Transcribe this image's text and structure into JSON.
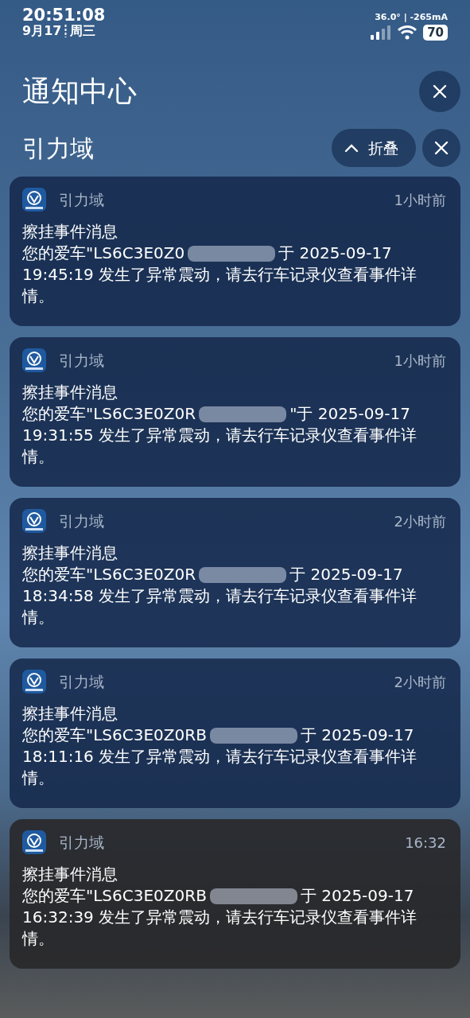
{
  "status_bar": {
    "time": "20:51:08",
    "date": "9月17",
    "weekday": "周三",
    "device_info": "36.0° | -265mA",
    "battery": "70"
  },
  "header": {
    "title": "通知中心"
  },
  "group": {
    "name": "引力域",
    "collapse_label": "折叠"
  },
  "notifications": [
    {
      "app": "引力域",
      "time": "1小时前",
      "title": "擦挂事件消息",
      "body_start": "您的爱车\"LS6C3E0Z0",
      "body_mid": "于 2025-09-17",
      "body_end": "19:45:19 发生了异常震动，请去行车记录仪查看事件详情。",
      "kind": "blue"
    },
    {
      "app": "引力域",
      "time": "1小时前",
      "title": "擦挂事件消息",
      "body_start": "您的爱车\"LS6C3E0Z0R",
      "body_mid": "\"于 2025-09-17",
      "body_end": "19:31:55 发生了异常震动，请去行车记录仪查看事件详情。",
      "kind": "blue"
    },
    {
      "app": "引力域",
      "time": "2小时前",
      "title": "擦挂事件消息",
      "body_start": "您的爱车\"LS6C3E0Z0R",
      "body_mid": "于 2025-09-17",
      "body_end": "18:34:58 发生了异常震动，请去行车记录仪查看事件详情。",
      "kind": "blue"
    },
    {
      "app": "引力域",
      "time": "2小时前",
      "title": "擦挂事件消息",
      "body_start": "您的爱车\"LS6C3E0Z0RB",
      "body_mid": "于 2025-09-17",
      "body_end": "18:11:16 发生了异常震动，请去行车记录仪查看事件详情。",
      "kind": "blue"
    },
    {
      "app": "引力域",
      "time": "16:32",
      "title": "擦挂事件消息",
      "body_start": "您的爱车\"LS6C3E0Z0RB",
      "body_mid": "于 2025-09-17",
      "body_end": "16:32:39 发生了异常震动，请去行车记录仪查看事件详情。",
      "kind": "dark"
    }
  ]
}
